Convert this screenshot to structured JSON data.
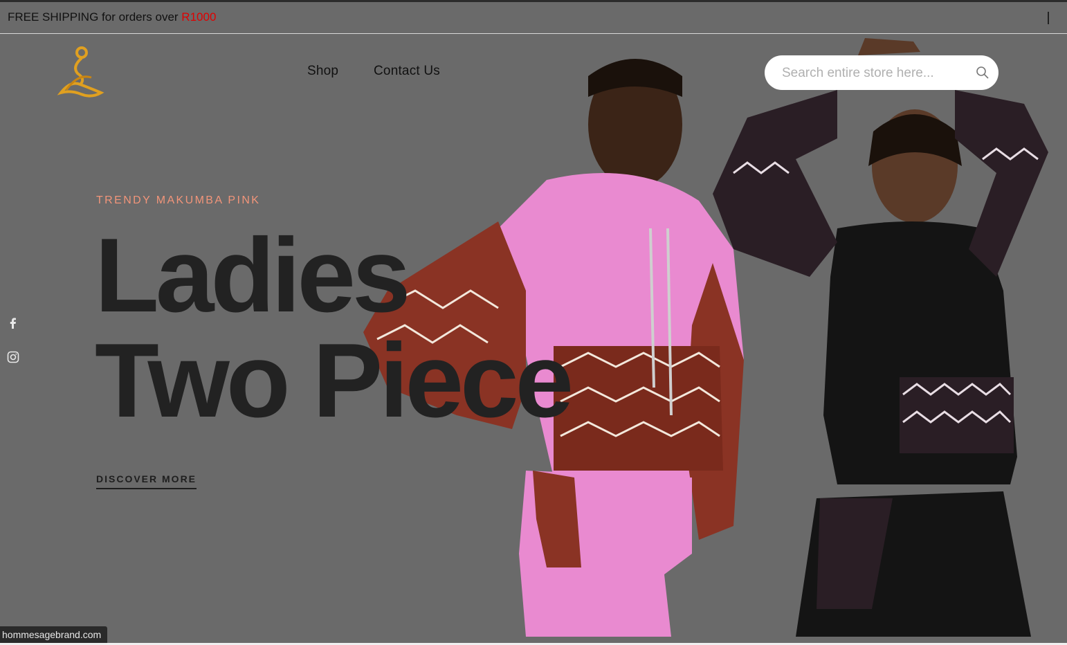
{
  "announcement": {
    "prefix": "FREE SHIPPING for orders over ",
    "amount": "R1000"
  },
  "header": {
    "logo": "brand-logo",
    "nav": [
      {
        "label": "Shop"
      },
      {
        "label": "Contact Us"
      }
    ],
    "search": {
      "placeholder": "Search entire store here...",
      "value": "",
      "icon": "search-icon"
    }
  },
  "social": [
    {
      "icon": "facebook-icon"
    },
    {
      "icon": "instagram-icon"
    }
  ],
  "hero": {
    "eyebrow": "TRENDY MAKUMBA PINK",
    "title_line1": "Ladies",
    "title_line2": "Two Piece",
    "cta": "DISCOVER MORE",
    "image": "two-models-photo"
  },
  "status_bar": {
    "url": "hommesagebrand.com"
  },
  "colors": {
    "background": "#6a6a6a",
    "accent": "#e00000",
    "eyebrow": "#f2957a",
    "logo_gold": "#e0a020",
    "headline": "#222222"
  }
}
